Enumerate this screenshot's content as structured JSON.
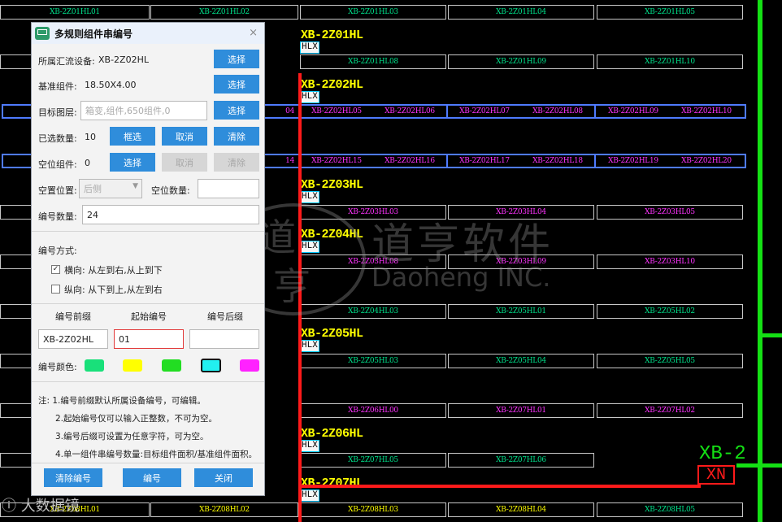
{
  "dialog": {
    "title": "多规则组件串编号",
    "close_glyph": "×",
    "device_label": "所属汇流设备:",
    "device_value": "XB-2Z02HL",
    "select_label": "选择",
    "base_label": "基准组件:",
    "base_value": "18.50X4.00",
    "target_label": "目标图层:",
    "target_placeholder": "箱变,组件,650组件,0",
    "selected_label": "已选数量:",
    "selected_value": "10",
    "frame_select_label": "框选",
    "cancel_label": "取消",
    "clear_label": "清除",
    "empty_label": "空位组件:",
    "empty_value": "0",
    "empty_pos_label": "空置位置:",
    "empty_pos_value": "后侧",
    "empty_count_label": "空位数量:",
    "number_count_label": "编号数量:",
    "number_count_value": "24",
    "mode_label": "编号方式:",
    "horizontal_label": "横向: 从左到右,从上到下",
    "vertical_label": "纵向: 从下到上,从左到右",
    "prefix_header": "编号前缀",
    "start_header": "起始编号",
    "suffix_header": "编号后缀",
    "prefix_value": "XB-2Z02HL",
    "start_value": "01",
    "suffix_value": "",
    "color_label": "编号颜色:",
    "colors": [
      "#19e07a",
      "#ffff00",
      "#22dd22",
      "#22f0f0",
      "#ff22ff"
    ],
    "notes": [
      "注: 1.编号前缀默认所属设备编号，可编辑。",
      "2.起始编号仅可以输入正整数，不可为空。",
      "3.编号后缀可设置为任意字符，可为空。",
      "4.单一组件串编号数量:目标组件面积/基准组件面积。"
    ],
    "clear_numbers_label": "清除编号",
    "number_label": "编号",
    "close_label": "关闭"
  },
  "cad": {
    "row1": [
      "XB-2Z01HL01",
      "XB-2Z01HL02",
      "XB-2Z01HL03",
      "XB-2Z01HL04",
      "XB-2Z01HL05"
    ],
    "row2": [
      "XB-2Z01HL08",
      "XB-2Z01HL09",
      "XB-2Z01HL10"
    ],
    "row3_left_tail": "04",
    "row3": [
      "XB-2Z02HL05",
      "XB-2Z02HL06",
      "XB-2Z02HL07",
      "XB-2Z02HL08",
      "XB-2Z02HL09",
      "XB-2Z02HL10"
    ],
    "row4_left_tail": "14",
    "row4": [
      "XB-2Z02HL15",
      "XB-2Z02HL16",
      "XB-2Z02HL17",
      "XB-2Z02HL18",
      "XB-2Z02HL19",
      "XB-2Z02HL20"
    ],
    "row5": [
      "XB-2Z03HL03",
      "XB-2Z03HL04",
      "XB-2Z03HL05"
    ],
    "row6": [
      "XB-2Z03HL08",
      "XB-2Z03HL09",
      "XB-2Z03HL10"
    ],
    "row7": [
      "XB-2Z04HL03",
      "XB-2Z05HL01",
      "XB-2Z05HL02"
    ],
    "row8": [
      "XB-2Z05HL03",
      "XB-2Z05HL04",
      "XB-2Z05HL05"
    ],
    "row9": [
      "XB-2Z06HL00",
      "XB-2Z07HL01",
      "XB-2Z07HL02"
    ],
    "row10": [
      "XB-2Z07HL05",
      "XB-2Z07HL06"
    ],
    "row11": [
      "XB-2Z08HL01",
      "XB-2Z08HL02",
      "XB-2Z08HL03",
      "XB-2Z08HL04",
      "XB-2Z08HL05"
    ],
    "row11_left_tail": "XB-2Z08HL01",
    "string_labels": [
      "XB-2Z01HL",
      "XB-2Z02HL",
      "XB-2Z03HL",
      "XB-2Z04HL",
      "XB-2Z05HL",
      "XB-2Z06HL",
      "XB-2Z07HL"
    ],
    "hlx": "HLX",
    "xb_big": "XB-2",
    "xn": "XN",
    "watermark_cn": "道亨软件",
    "watermark_en": "Daoheng INC.",
    "watermark_seal": [
      "道",
      "亨"
    ],
    "corner_logo": "ⓘ 大数据镜"
  }
}
